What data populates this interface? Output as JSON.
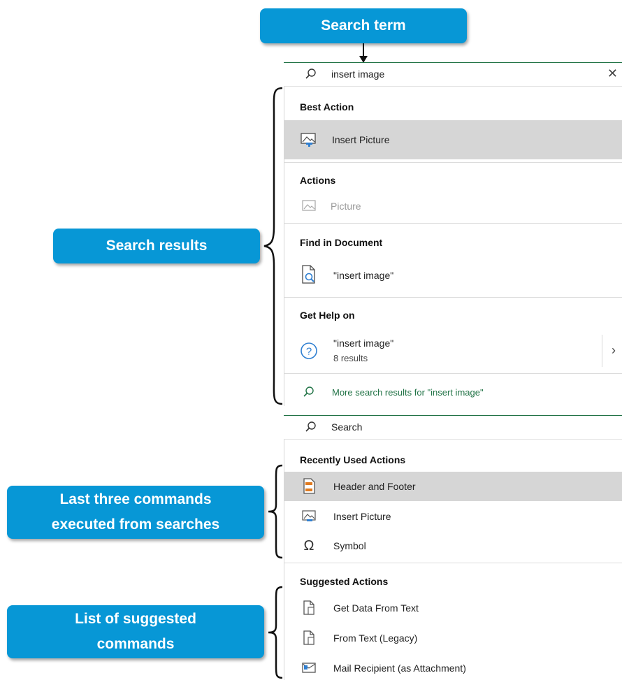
{
  "callouts": {
    "search_term": "Search term",
    "search_results": "Search results",
    "last_three_line1": "Last three commands",
    "last_three_line2": "executed from searches",
    "suggested_line1": "List of suggested",
    "suggested_line2": "commands"
  },
  "top_search": {
    "value": "insert image",
    "clear_icon": "close-icon"
  },
  "results": {
    "best_action_heading": "Best Action",
    "best_action_item": "Insert Picture",
    "actions_heading": "Actions",
    "actions_item": "Picture",
    "find_heading": "Find in Document",
    "find_item": "\"insert image\"",
    "help_heading": "Get Help on",
    "help_item": "\"insert image\"",
    "help_count": "8 results",
    "more_results": "More search results for \"insert image\""
  },
  "bottom_search": {
    "placeholder": "Search"
  },
  "recent": {
    "heading": "Recently Used Actions",
    "items": [
      "Header and Footer",
      "Insert Picture",
      "Symbol"
    ]
  },
  "suggested": {
    "heading": "Suggested Actions",
    "items": [
      "Get Data From Text",
      "From Text (Legacy)",
      "Mail Recipient (as Attachment)"
    ]
  },
  "colors": {
    "callout": "#0797d6",
    "highlight": "#d6d6d6",
    "search_green": "#217346"
  }
}
